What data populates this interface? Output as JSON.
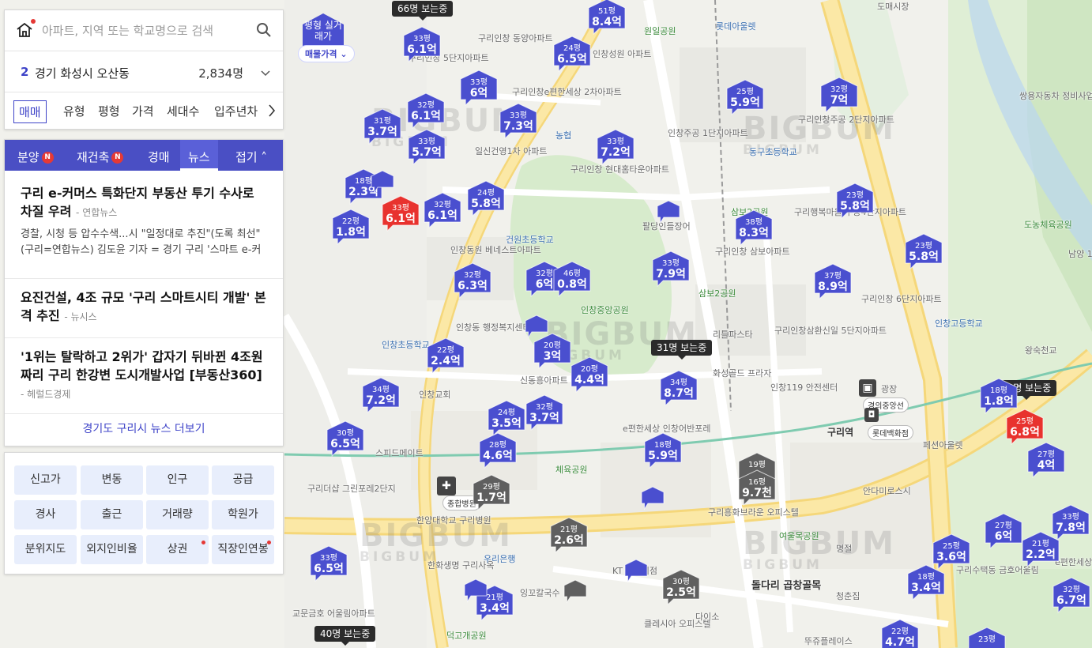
{
  "search": {
    "placeholder": "아파트, 지역 또는 학교명으로 검색",
    "region_count": "2",
    "region_name": "경기 화성시 오산동",
    "population": "2,834명",
    "filters": [
      "매매",
      "유형",
      "평형",
      "가격",
      "세대수",
      "입주년차"
    ]
  },
  "news_panel": {
    "tabs": [
      "분양",
      "재건축",
      "경매",
      "뉴스"
    ],
    "new_badge": "N",
    "collapse_label": "접기",
    "articles": [
      {
        "headline": "구리 e-커머스 특화단지 부동산 투기 수사로 차질 우려",
        "source": "연합뉴스",
        "body": "경찰, 시청 등 압수수색...시 \"일정대로 추진\"(도록 최선\"(구리=연합뉴스) 김도윤 기자 = 경기 구리 '스마트 e-커머스(전자상거래)' 특화단지 조성 사..."
      },
      {
        "headline": "요진건설, 4조 규모 '구리 스마트시티 개발' 본격 추진",
        "source": "뉴시스"
      },
      {
        "headline": "'1위는 탈락하고 2위가' 갑자기 뒤바뀐 4조원짜리 구리 한강변 도시개발사업 [부동산360]",
        "source": "헤럴드경제"
      }
    ],
    "more_link": "경기도 구리시 뉴스 더보기"
  },
  "layer_buttons": [
    "신고가",
    "변동",
    "인구",
    "공급",
    "경사",
    "출근",
    "거래량",
    "학원가",
    "분위지도",
    "외지인비율",
    "상권",
    "직장인연봉"
  ],
  "map": {
    "pyeong_toggle": "평형 실거래가",
    "price_toggle": "매물가격",
    "viewer_badges": [
      "66명 보는중",
      "31명 보는중",
      "30명 보는중",
      "40명 보는중"
    ],
    "station": "구리역",
    "station_lines": [
      "경의중앙선"
    ],
    "mall_label": "롯데백화점",
    "hospital_label": "종합병원",
    "watermark": "BIGBUM",
    "colors": {
      "blue": "#4a4fcf",
      "red": "#e8322e",
      "gray": "#5f5f5f",
      "panel_accent": "#4a4fc4"
    },
    "pois": [
      "도매시장",
      "원일공원",
      "롯데아울렛",
      "구리인창 동양아파트",
      "구리인창 5단지아파트",
      "구리인창e편한세상 2차아파트",
      "인창성원 아파트",
      "일신건영1차 아파트",
      "농협",
      "구리인창 현대홈타운아파트",
      "인창주공 1단지아파트",
      "동구초등학교",
      "구리인창주공 2단지아파트",
      "쌍용자동차 정비사업소",
      "도농체육공원",
      "남양 1단",
      "팔당인들장어",
      "삼보2공원",
      "구리행복마을 주공4단지아파트",
      "건원초등학교",
      "인창동원 베네스트아파트",
      "구리인창 삼보아파트",
      "인창중앙공원",
      "삼보2공원",
      "구리인창 6단지아파트",
      "인창고등학교",
      "인창동 행정복지센터",
      "인창초등학교",
      "리틀파스타",
      "구리인창삼환신일 5단지아파트",
      "왕숙천교",
      "인창교회",
      "신동흥아파트",
      "화성골드 프라자",
      "인창119 안전센터",
      "광장",
      "페션아울렛",
      "구리더샵 그린포레2단지",
      "스피드메이트",
      "체육공원",
      "e편한세상 인창어반포레",
      "안다미로스시",
      "한양대학교 구리병원",
      "구리흥화브라운 오피스텔",
      "여울목공원",
      "명절",
      "돌다리 곱창골목",
      "한화생명 구리사옥",
      "우리은행",
      "잉꼬칼국수",
      "KT 구리지점",
      "다이소",
      "클레시아 오피스텔",
      "교문금호 어울림아파트",
      "덕고개공원",
      "청춘집",
      "뚜쥬플레이스",
      "구리수택동 금호어울림",
      "e편한세상 아파트"
    ],
    "markers": [
      {
        "size": "평형",
        "price": "",
        "color": "blue"
      },
      {
        "size": "51평",
        "price": "8.4억",
        "color": "blue"
      },
      {
        "size": "33평",
        "price": "6.1억",
        "color": "blue"
      },
      {
        "size": "24평",
        "price": "6.5억",
        "color": "blue"
      },
      {
        "size": "33평",
        "price": "6억",
        "color": "blue"
      },
      {
        "size": "32평",
        "price": "6.1억",
        "color": "blue"
      },
      {
        "size": "33평",
        "price": "7.3억",
        "color": "blue"
      },
      {
        "size": "31평",
        "price": "3.7억",
        "color": "blue"
      },
      {
        "size": "33평",
        "price": "5.7억",
        "color": "blue"
      },
      {
        "size": "25평",
        "price": "5.9억",
        "color": "blue"
      },
      {
        "size": "32평",
        "price": "7억",
        "color": "blue"
      },
      {
        "size": "33평",
        "price": "7.2억",
        "color": "blue"
      },
      {
        "size": "18평",
        "price": "2.3억",
        "color": "blue"
      },
      {
        "size": "22평",
        "price": "1.8억",
        "color": "blue"
      },
      {
        "size": "33평",
        "price": "6.1억",
        "color": "red"
      },
      {
        "size": "32평",
        "price": "6.1억",
        "color": "blue"
      },
      {
        "size": "24평",
        "price": "5.8억",
        "color": "blue"
      },
      {
        "size": "23평",
        "price": "5.8억",
        "color": "blue"
      },
      {
        "size": "38평",
        "price": "8.3억",
        "color": "blue"
      },
      {
        "size": "23평",
        "price": "5.8억",
        "color": "blue"
      },
      {
        "size": "32평",
        "price": "6.3억",
        "color": "blue"
      },
      {
        "size": "32평",
        "price": "6억",
        "color": "blue"
      },
      {
        "size": "46평",
        "price": "0.8억",
        "color": "blue"
      },
      {
        "size": "33평",
        "price": "7.9억",
        "color": "blue"
      },
      {
        "size": "37평",
        "price": "8.9억",
        "color": "blue"
      },
      {
        "size": "22평",
        "price": "2.4억",
        "color": "blue"
      },
      {
        "size": "20평",
        "price": "3억",
        "color": "blue"
      },
      {
        "size": "20평",
        "price": "4.4억",
        "color": "blue"
      },
      {
        "size": "34평",
        "price": "8.7억",
        "color": "blue"
      },
      {
        "size": "34평",
        "price": "7.2억",
        "color": "blue"
      },
      {
        "size": "24평",
        "price": "3.5억",
        "color": "blue"
      },
      {
        "size": "32평",
        "price": "3.7억",
        "color": "blue"
      },
      {
        "size": "30평",
        "price": "6.5억",
        "color": "blue"
      },
      {
        "size": "28평",
        "price": "4.6억",
        "color": "blue"
      },
      {
        "size": "18평",
        "price": "5.9억",
        "color": "blue"
      },
      {
        "size": "19평",
        "price": "",
        "color": "gray"
      },
      {
        "size": "16평",
        "price": "9.7천",
        "color": "gray"
      },
      {
        "size": "29평",
        "price": "1.7억",
        "color": "gray"
      },
      {
        "size": "21평",
        "price": "2.6억",
        "color": "gray"
      },
      {
        "size": "30평",
        "price": "2.5억",
        "color": "gray"
      },
      {
        "size": "33평",
        "price": "6.5억",
        "color": "blue"
      },
      {
        "size": "21평",
        "price": "3.4억",
        "color": "blue"
      },
      {
        "size": "18평",
        "price": "1.8억",
        "color": "blue"
      },
      {
        "size": "25평",
        "price": "6.8억",
        "color": "red"
      },
      {
        "size": "27평",
        "price": "4억",
        "color": "blue"
      },
      {
        "size": "33평",
        "price": "7.8억",
        "color": "blue"
      },
      {
        "size": "27평",
        "price": "6억",
        "color": "blue"
      },
      {
        "size": "25평",
        "price": "3.6억",
        "color": "blue"
      },
      {
        "size": "21평",
        "price": "2.2억",
        "color": "blue"
      },
      {
        "size": "18평",
        "price": "3.4억",
        "color": "blue"
      },
      {
        "size": "32평",
        "price": "6.7억",
        "color": "blue"
      },
      {
        "size": "22평",
        "price": "4.7억",
        "color": "blue"
      },
      {
        "size": "23평",
        "price": "",
        "color": "blue"
      },
      {
        "size": "",
        "price": "",
        "color": "blue"
      },
      {
        "size": "",
        "price": "",
        "color": "blue"
      },
      {
        "size": "",
        "price": "",
        "color": "blue"
      },
      {
        "size": "",
        "price": "",
        "color": "gray"
      },
      {
        "size": "",
        "price": "",
        "color": "blue"
      },
      {
        "size": "",
        "price": "",
        "color": "blue"
      },
      {
        "size": "",
        "price": "",
        "color": "blue"
      }
    ]
  }
}
